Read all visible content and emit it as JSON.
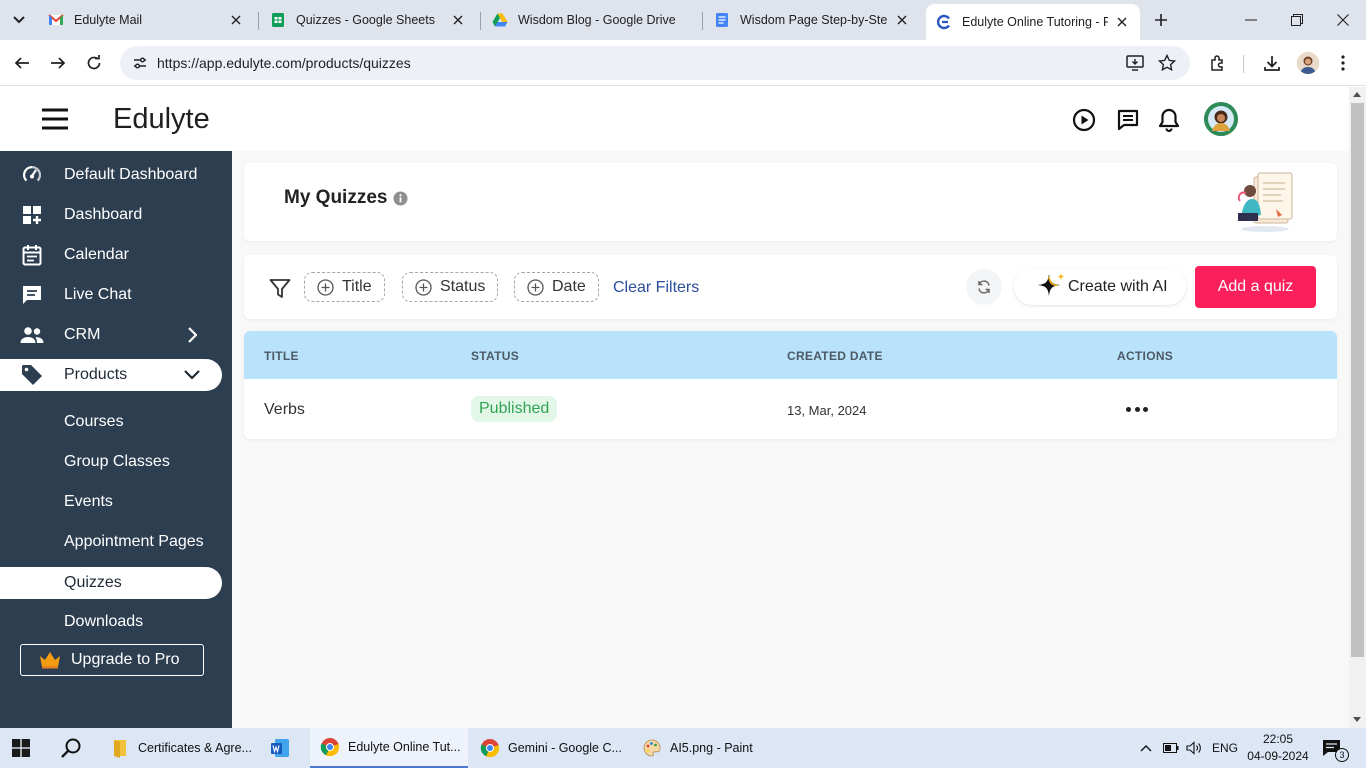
{
  "browser": {
    "tabs": [
      {
        "label": "Edulyte Mail"
      },
      {
        "label": "Quizzes - Google Sheets"
      },
      {
        "label": "Wisdom Blog - Google Drive"
      },
      {
        "label": "Wisdom Page Step-by-Step"
      },
      {
        "label": "Edulyte Online Tutoring - Pe"
      }
    ],
    "url": "https://app.edulyte.com/products/quizzes"
  },
  "app": {
    "brand": "Edulyte"
  },
  "sidebar": {
    "items": [
      {
        "label": "Default Dashboard"
      },
      {
        "label": "Dashboard"
      },
      {
        "label": "Calendar"
      },
      {
        "label": "Live Chat"
      },
      {
        "label": "CRM"
      },
      {
        "label": "Products"
      }
    ],
    "sub_items": [
      {
        "label": "Courses"
      },
      {
        "label": "Group Classes"
      },
      {
        "label": "Events"
      },
      {
        "label": "Appointment Pages"
      },
      {
        "label": "Quizzes"
      },
      {
        "label": "Downloads"
      }
    ],
    "upgrade_label": "Upgrade to Pro"
  },
  "main": {
    "title": "My Quizzes",
    "filters": {
      "title_chip": "Title",
      "status_chip": "Status",
      "date_chip": "Date",
      "clear_label": "Clear Filters"
    },
    "create_ai_label": "Create with AI",
    "add_quiz_label": "Add a quiz",
    "table": {
      "headers": {
        "title": "TITLE",
        "status": "STATUS",
        "created": "CREATED DATE",
        "actions": "ACTIONS"
      },
      "rows": [
        {
          "title": "Verbs",
          "status": "Published",
          "created": "13, Mar, 2024"
        }
      ]
    }
  },
  "taskbar": {
    "items": [
      {
        "label": "Certificates & Agre..."
      },
      {
        "label": "Edulyte Online Tut..."
      },
      {
        "label": "Gemini - Google C..."
      },
      {
        "label": "AI5.png - Paint"
      }
    ],
    "lang": "ENG",
    "time": "22:05",
    "date": "04-09-2024",
    "notification_count": "3"
  },
  "colors": {
    "sidebar_bg": "#2d3e50",
    "accent_pink": "#fb1f5c",
    "table_header_bg": "#b9e3fb",
    "badge_green": "#31a453"
  }
}
